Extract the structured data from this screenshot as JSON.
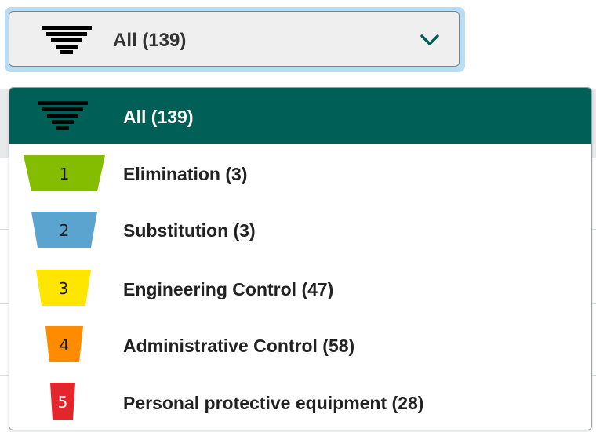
{
  "select": {
    "value_label": "All (139)",
    "icon": "funnel-stack-icon",
    "chevron_icon": "chevron-down-icon"
  },
  "options": [
    {
      "label": "All (139)",
      "icon": "funnel-stack-icon",
      "selected": true
    },
    {
      "label": "Elimination (3)",
      "level": "1",
      "color": "#84bd00",
      "text_color": "#1a1a1a"
    },
    {
      "label": "Substitution (3)",
      "level": "2",
      "color": "#5ba4cf",
      "text_color": "#1a1a1a"
    },
    {
      "label": "Engineering Control (47)",
      "level": "3",
      "color": "#ffe600",
      "text_color": "#1a1a1a"
    },
    {
      "label": "Administrative Control (58)",
      "level": "4",
      "color": "#ff8c00",
      "text_color": "#1a1a1a"
    },
    {
      "label": "Personal protective equipment (28)",
      "level": "5",
      "color": "#e3262b",
      "text_color": "#ffffff"
    }
  ],
  "colors": {
    "selected_bg": "#005f57",
    "focus_ring": "#b7dcf4",
    "control_bg": "#efefef"
  }
}
